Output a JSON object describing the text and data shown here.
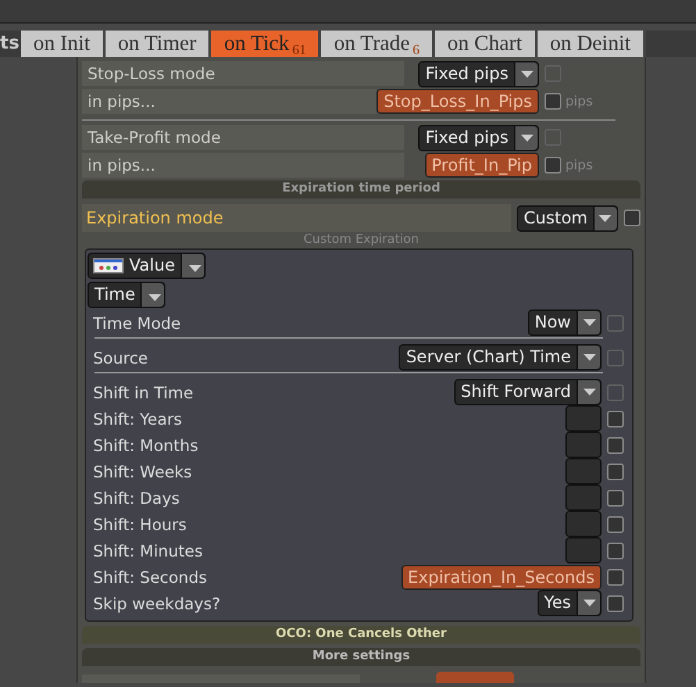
{
  "header_fragment": "ts",
  "tabs": [
    {
      "label": "on Init",
      "selected": false
    },
    {
      "label": "on Timer",
      "selected": false
    },
    {
      "label": "on Tick",
      "badge": "61",
      "selected": true
    },
    {
      "label": "on Trade",
      "badge": "6",
      "selected": false
    },
    {
      "label": "on Chart",
      "selected": false
    },
    {
      "label": "on Deinit",
      "selected": false
    }
  ],
  "top_groups": [
    {
      "rows": [
        {
          "kind": "dropdown",
          "label": "Stop-Loss mode",
          "value": "Fixed pips",
          "checkbox": {
            "checked": false,
            "disabled": true
          }
        },
        {
          "kind": "field",
          "label": "in pips...",
          "value": "Stop_Loss_In_Pips",
          "checkbox": {
            "checked": false,
            "disabled": false
          },
          "unit": "pips"
        }
      ]
    },
    {
      "rows": [
        {
          "kind": "dropdown",
          "label": "Take-Profit mode",
          "value": "Fixed pips",
          "checkbox": {
            "checked": false,
            "disabled": true
          }
        },
        {
          "kind": "field",
          "label": "in pips...",
          "value": "Profit_In_Pip",
          "checkbox": {
            "checked": false,
            "disabled": false
          },
          "unit": "pips"
        }
      ]
    }
  ],
  "expiration": {
    "title": "Expiration time period",
    "mode_label": "Expiration mode",
    "mode_value": "Custom",
    "mode_checkbox": {
      "checked": false,
      "disabled": false
    },
    "subtitle": "Custom Expiration",
    "value_selector": "Value",
    "type_selector": "Time",
    "rows": [
      {
        "kind": "dropdown",
        "label": "Time Mode",
        "value": "Now",
        "checkbox": {
          "checked": false,
          "disabled": true
        },
        "separated": true
      },
      {
        "kind": "dropdown",
        "label": "Source",
        "value": "Server (Chart) Time",
        "checkbox": {
          "checked": false,
          "disabled": true
        },
        "separated": true
      },
      {
        "kind": "dropdown",
        "label": "Shift in Time",
        "value": "Shift Forward",
        "checkbox": {
          "checked": false,
          "disabled": true
        },
        "separated": false
      },
      {
        "kind": "number",
        "label": "Shift: Years",
        "checkbox": {
          "checked": false,
          "disabled": false
        },
        "separated": false
      },
      {
        "kind": "number",
        "label": "Shift: Months",
        "checkbox": {
          "checked": false,
          "disabled": false
        },
        "separated": false
      },
      {
        "kind": "number",
        "label": "Shift: Weeks",
        "checkbox": {
          "checked": false,
          "disabled": false
        },
        "separated": false
      },
      {
        "kind": "number",
        "label": "Shift: Days",
        "checkbox": {
          "checked": false,
          "disabled": false
        },
        "separated": false
      },
      {
        "kind": "number",
        "label": "Shift: Hours",
        "checkbox": {
          "checked": false,
          "disabled": false
        },
        "separated": false
      },
      {
        "kind": "number",
        "label": "Shift: Minutes",
        "checkbox": {
          "checked": false,
          "disabled": false
        },
        "separated": false
      },
      {
        "kind": "field",
        "label": "Shift: Seconds",
        "value": "Expiration_In_Seconds",
        "checkbox": {
          "checked": false,
          "disabled": false
        },
        "separated": false
      },
      {
        "kind": "dropdown",
        "label": "Skip weekdays?",
        "value": "Yes",
        "checkbox": {
          "checked": false,
          "disabled": false
        },
        "separated": false
      }
    ]
  },
  "sections": [
    {
      "title": "OCO: One Cancels Other",
      "selected": true
    },
    {
      "title": "More settings",
      "selected": false
    }
  ]
}
